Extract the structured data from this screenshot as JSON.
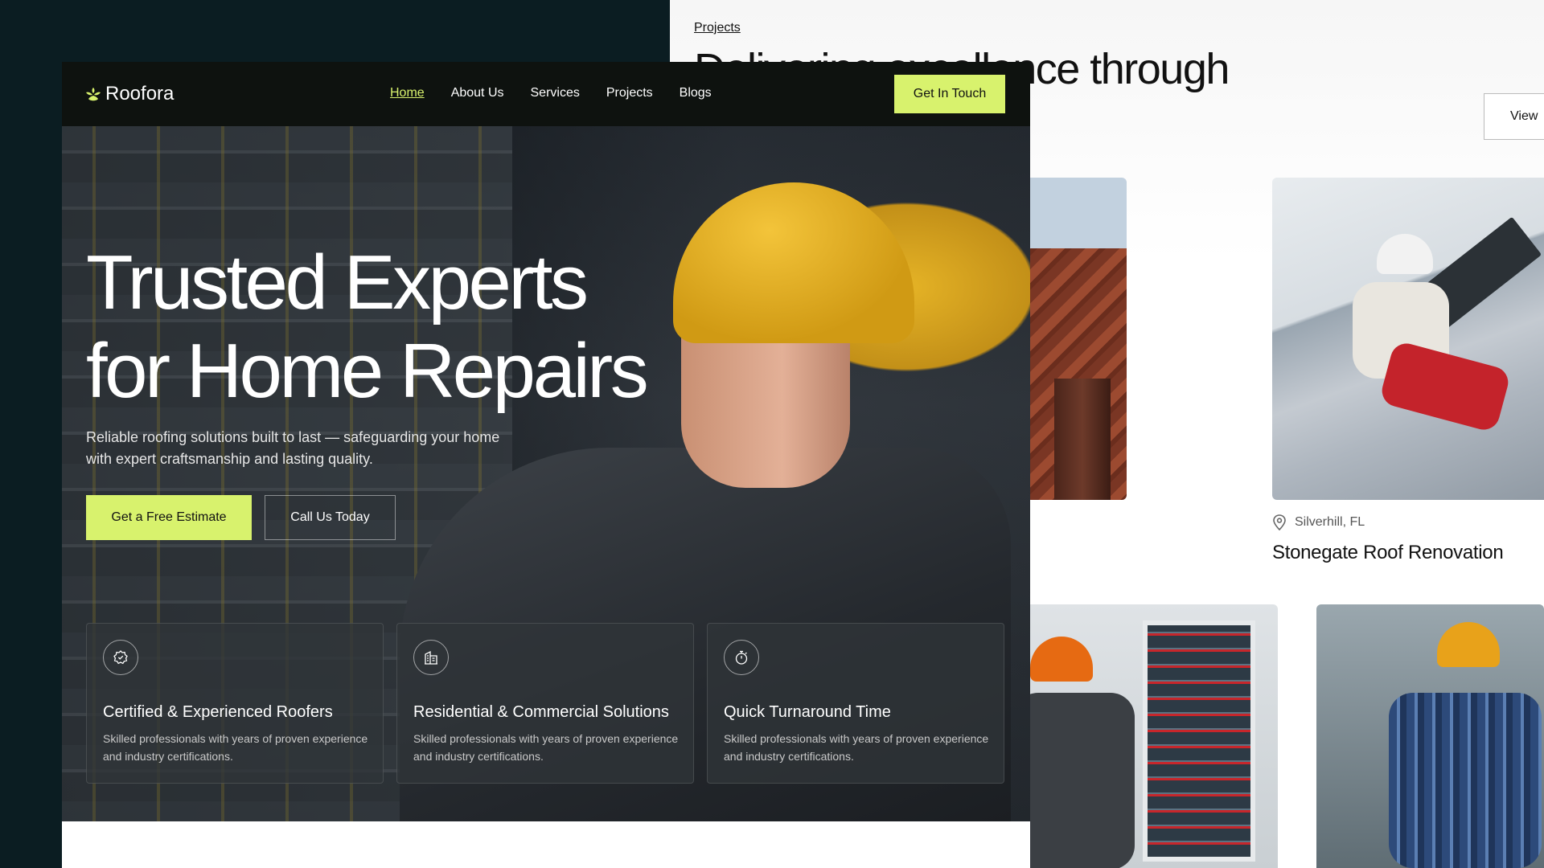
{
  "background_page": {
    "breadcrumb": "Projects",
    "headline": "Delivering excellence through results",
    "view_button": "View",
    "project": {
      "location": "Silverhill, FL",
      "title": "Stonegate Roof Renovation"
    }
  },
  "nav": {
    "logo_text": "Roofora",
    "links": [
      "Home",
      "About Us",
      "Services",
      "Projects",
      "Blogs"
    ],
    "active_link": "Home",
    "cta": "Get In Touch"
  },
  "hero": {
    "title_line1": "Trusted Experts",
    "title_line2": "for Home Repairs",
    "subtitle": "Reliable roofing solutions built to last — safeguarding your home with expert craftsmanship and lasting quality.",
    "primary_button": "Get a Free Estimate",
    "secondary_button": "Call Us Today"
  },
  "features": [
    {
      "icon": "badge-icon",
      "title": "Certified & Experienced Roofers",
      "desc": "Skilled professionals with years of proven experience and industry certifications."
    },
    {
      "icon": "building-icon",
      "title": "Residential & Commercial Solutions",
      "desc": "Skilled professionals with years of proven experience and industry certifications."
    },
    {
      "icon": "stopwatch-icon",
      "title": "Quick Turnaround Time",
      "desc": "Skilled professionals with years of proven experience and industry certifications."
    }
  ],
  "colors": {
    "accent": "#d8f26d",
    "nav_bg": "#0e120f",
    "page_bg": "#0b1d22"
  }
}
